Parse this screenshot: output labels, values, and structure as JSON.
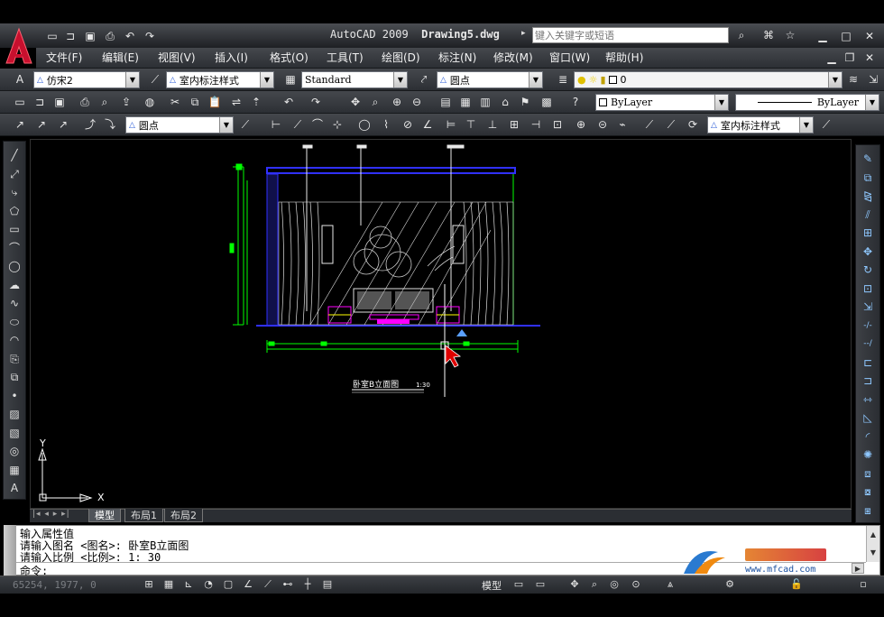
{
  "title_bar": {
    "app_name": "AutoCAD 2009",
    "file_name": "Drawing5.dwg",
    "search_placeholder": "键入关键字或短语"
  },
  "menu": [
    {
      "label": "文件(F)"
    },
    {
      "label": "编辑(E)"
    },
    {
      "label": "视图(V)"
    },
    {
      "label": "插入(I)"
    },
    {
      "label": "格式(O)"
    },
    {
      "label": "工具(T)"
    },
    {
      "label": "绘图(D)"
    },
    {
      "label": "标注(N)"
    },
    {
      "label": "修改(M)"
    },
    {
      "label": "窗口(W)"
    },
    {
      "label": "帮助(H)"
    }
  ],
  "toolbar1": {
    "text_style": "仿宋2",
    "dim_style": "室内标注样式",
    "table_style": "Standard",
    "multileader_style": "圆点",
    "layer": "0"
  },
  "toolbar2": {
    "color": "ByLayer",
    "linetype": "ByLayer"
  },
  "toolbar3": {
    "leader_style": "圆点",
    "dim_style": "室内标注样式"
  },
  "drawing": {
    "caption": "卧室B立面图",
    "scale_text": "1:30"
  },
  "ucs": {
    "x_label": "X",
    "y_label": "Y"
  },
  "tabs": [
    {
      "label": "模型"
    },
    {
      "label": "布局1"
    },
    {
      "label": "布局2"
    }
  ],
  "command": {
    "line1": "输入属性值",
    "line2": "请输入图名 <图名>: 卧室B立面图",
    "line3": "请输入比例 <比例>: 1: 30",
    "prompt": "命令:"
  },
  "status": {
    "coords": "65254, 1977, 0",
    "model_label": "模型",
    "watermark_site": "www.mfcad.com"
  },
  "colors": {
    "accent_red": "#c8102e",
    "drawing_green": "#00ff00",
    "drawing_blue": "#3030ff",
    "drawing_magenta": "#ff00ff"
  }
}
